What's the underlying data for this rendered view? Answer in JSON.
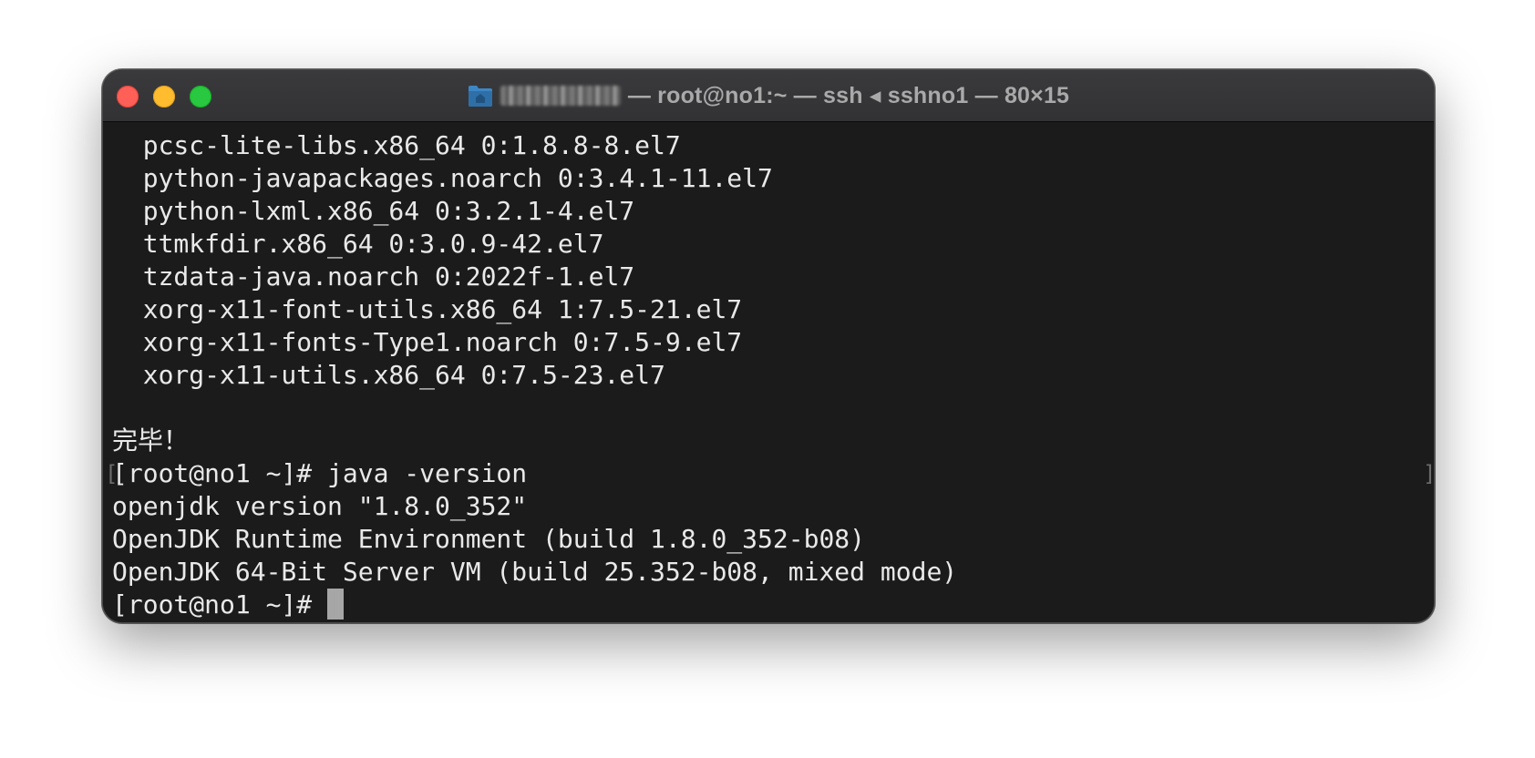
{
  "window": {
    "title_prefix_blurred": true,
    "title": "— root@no1:~ — ssh ◂ sshno1 — 80×15",
    "icon": "folder-icon"
  },
  "terminal": {
    "lines": [
      "  pcsc-lite-libs.x86_64 0:1.8.8-8.el7",
      "  python-javapackages.noarch 0:3.4.1-11.el7",
      "  python-lxml.x86_64 0:3.2.1-4.el7",
      "  ttmkfdir.x86_64 0:3.0.9-42.el7",
      "  tzdata-java.noarch 0:2022f-1.el7",
      "  xorg-x11-font-utils.x86_64 1:7.5-21.el7",
      "  xorg-x11-fonts-Type1.noarch 0:7.5-9.el7",
      "  xorg-x11-utils.x86_64 0:7.5-23.el7",
      "",
      "完毕！",
      "[root@no1 ~]# java -version",
      "openjdk version \"1.8.0_352\"",
      "OpenJDK Runtime Environment (build 1.8.0_352-b08)",
      "OpenJDK 64-Bit Server VM (build 25.352-b08, mixed mode)"
    ],
    "prompt": "[root@no1 ~]# ",
    "mark_left": "[",
    "mark_right": "]"
  },
  "colors": {
    "background": "#1b1b1b",
    "text": "#e9e9e9",
    "cursor": "#a6a6a6",
    "close": "#fe5f57",
    "minimize": "#febc2e",
    "zoom": "#28c840"
  }
}
